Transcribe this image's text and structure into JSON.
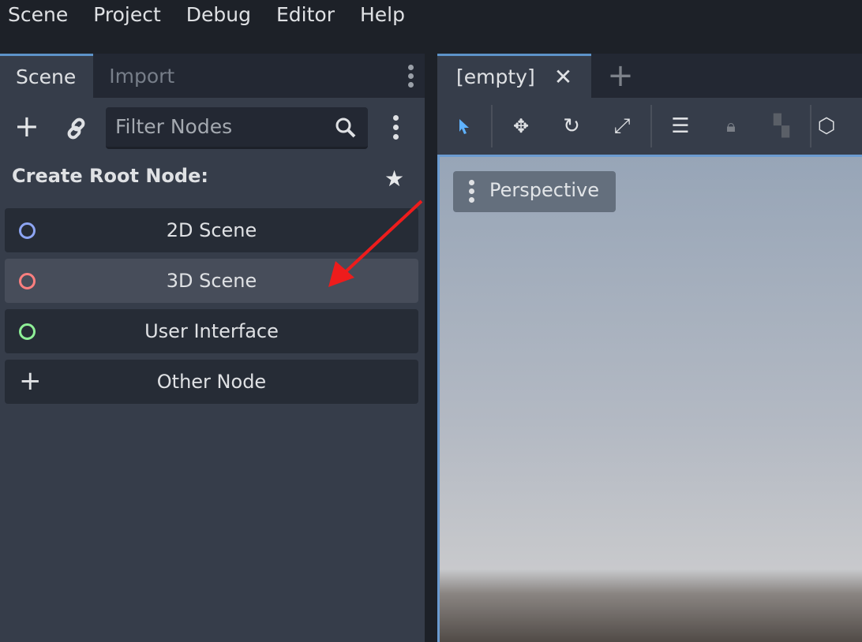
{
  "menubar": {
    "items": [
      "Scene",
      "Project",
      "Debug",
      "Editor",
      "Help"
    ]
  },
  "scene_dock": {
    "tabs": [
      "Scene",
      "Import"
    ],
    "filter_placeholder": "Filter Nodes",
    "create_root_label": "Create Root Node:",
    "nodes": [
      {
        "label": "2D Scene",
        "icon": "circle-icon",
        "color": "#8da5f3"
      },
      {
        "label": "3D Scene",
        "icon": "circle-icon",
        "color": "#fc7f7f"
      },
      {
        "label": "User Interface",
        "icon": "circle-icon",
        "color": "#8eef97"
      },
      {
        "label": "Other Node",
        "icon": "plus-icon"
      }
    ]
  },
  "editor": {
    "tab_label": "[empty]",
    "viewport_menu": "Perspective",
    "accent": "#5d93c9"
  }
}
